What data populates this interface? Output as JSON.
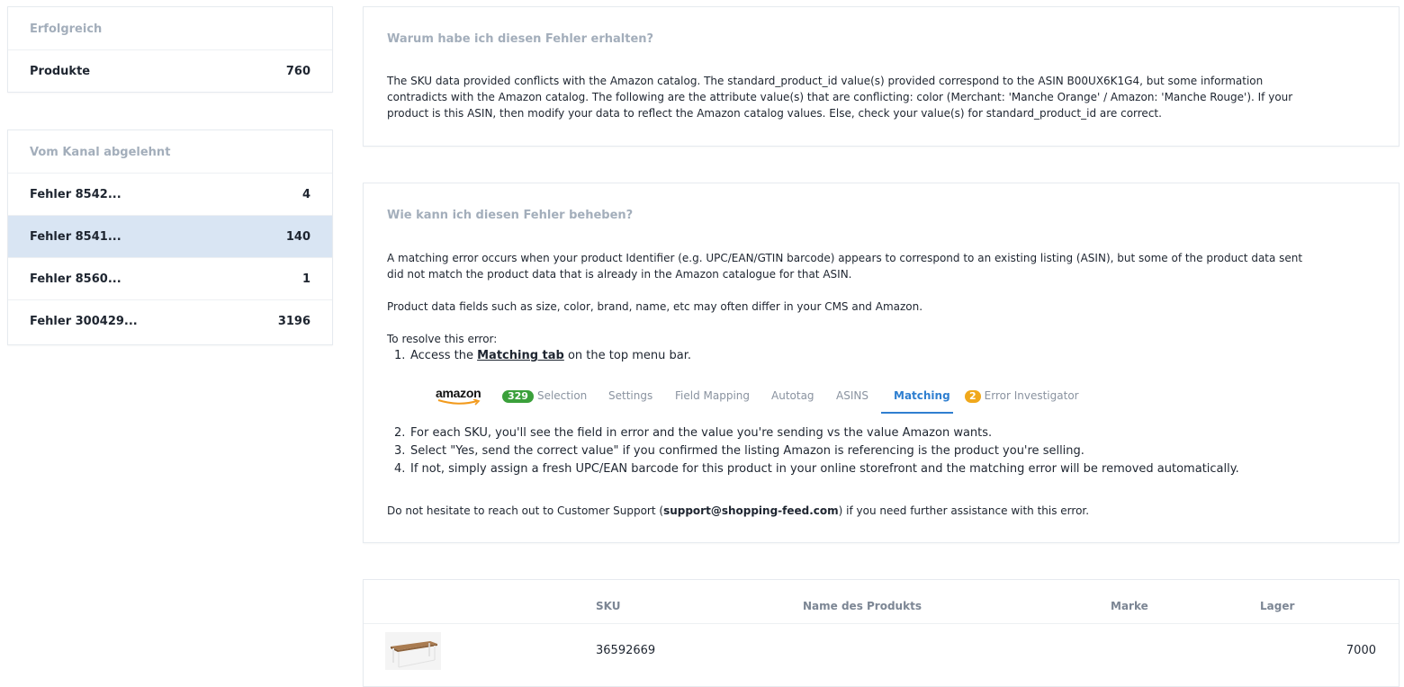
{
  "success_panel": {
    "title": "Erfolgreich",
    "rows": [
      {
        "label": "Produkte",
        "count": "760"
      }
    ]
  },
  "rejected_panel": {
    "title": "Vom Kanal abgelehnt",
    "rows": [
      {
        "label": "Fehler 8542...",
        "count": "4"
      },
      {
        "label": "Fehler 8541...",
        "count": "140"
      },
      {
        "label": "Fehler 8560...",
        "count": "1"
      },
      {
        "label": "Fehler 300429...",
        "count": "3196"
      }
    ],
    "selected_index": 1
  },
  "why_card": {
    "title": "Warum habe ich diesen Fehler erhalten?",
    "lines": [
      "The SKU data provided conflicts with the Amazon catalog. The standard_product_id value(s) provided correspond to the ASIN B00UX6K1G4, but some information",
      "contradicts with the Amazon catalog. The following are the attribute value(s) that are conflicting: color (Merchant: 'Manche Orange' / Amazon: 'Manche Rouge'). If your",
      "product is this ASIN, then modify your data to reflect the Amazon catalog values. Else, check your value(s) for standard_product_id are correct."
    ]
  },
  "fix_card": {
    "title": "Wie kann ich diesen Fehler beheben?",
    "para1_lines": [
      "A matching error occurs when your product Identifier (e.g. UPC/EAN/GTIN barcode) appears to correspond to an existing listing (ASIN), but some of the product data sent",
      "did not match the product data that is already in the Amazon catalogue for that ASIN."
    ],
    "para2": "Product data fields such as size, color, brand, name, etc may often differ in your CMS and Amazon.",
    "resolve_intro": "To resolve this error:",
    "step1": {
      "num": "1.",
      "before": "Access the ",
      "link": "Matching tab",
      "after": " on the top menu bar."
    },
    "tabs": {
      "logo": "amazon",
      "selection_badge": "329",
      "selection": "Selection",
      "settings": "Settings",
      "field_mapping": "Field Mapping",
      "autotag": "Autotag",
      "asins": "ASINS",
      "matching": "Matching",
      "error_badge": "2",
      "error_investigator": "Error Investigator",
      "active_color": "#2f7fd0"
    },
    "steps": [
      {
        "num": "2.",
        "text": "For each SKU, you'll see the field in error and the value you're sending vs the value Amazon wants."
      },
      {
        "num": "3.",
        "text": "Select \"Yes, send the correct value\" if you confirmed the listing Amazon is referencing is the product you're selling."
      },
      {
        "num": "4.",
        "text": "If not, simply assign a fresh UPC/EAN barcode for this product in your online storefront and the matching error will be removed automatically."
      }
    ],
    "support": {
      "before": "Do not hesitate to reach out to Customer Support (",
      "email": "support@shopping-feed.com",
      "after": ") if you need further assistance with this error."
    }
  },
  "product_table": {
    "columns": {
      "sku": "SKU",
      "name": "Name des Produkts",
      "brand": "Marke",
      "stock": "Lager"
    },
    "rows": [
      {
        "sku": "36592669",
        "name": "",
        "brand": "",
        "stock": "7000"
      }
    ]
  }
}
